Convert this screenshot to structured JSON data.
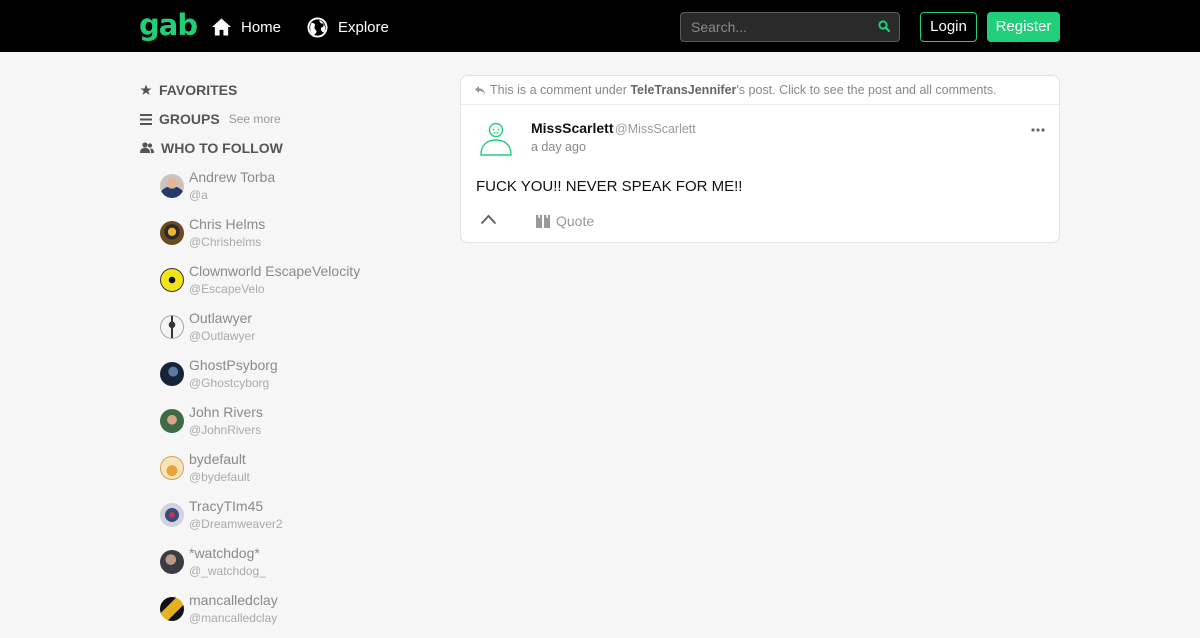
{
  "header": {
    "logo": "gab",
    "nav": [
      {
        "label": "Home",
        "icon": "home-icon"
      },
      {
        "label": "Explore",
        "icon": "globe-icon"
      }
    ],
    "search": {
      "placeholder": "Search..."
    },
    "login_label": "Login",
    "register_label": "Register"
  },
  "sidebar": {
    "favorites_label": "FAVORITES",
    "groups_label": "GROUPS",
    "groups_see_more": "See more",
    "who_to_follow_label": "WHO TO FOLLOW",
    "follow": [
      {
        "name": "Andrew Torba",
        "handle": "@a"
      },
      {
        "name": "Chris Helms",
        "handle": "@Chrishelms"
      },
      {
        "name": "Clownworld EscapeVelocity",
        "handle": "@EscapeVelo"
      },
      {
        "name": "Outlawyer",
        "handle": "@Outlawyer"
      },
      {
        "name": "GhostPsyborg",
        "handle": "@Ghostcyborg"
      },
      {
        "name": "John Rivers",
        "handle": "@JohnRivers"
      },
      {
        "name": "bydefault",
        "handle": "@bydefault"
      },
      {
        "name": "TracyTIm45",
        "handle": "@Dreamweaver2"
      },
      {
        "name": "*watchdog*",
        "handle": "@_watchdog_"
      },
      {
        "name": "mancalledclay",
        "handle": "@mancalledclay"
      }
    ]
  },
  "post": {
    "note_prefix": "This is a comment under ",
    "note_user": "TeleTransJennifer",
    "note_suffix": "'s post. Click to see the post and all comments.",
    "author_name": "MissScarlett",
    "author_handle": "@MissScarlett",
    "time": "a day ago",
    "body": "FUCK YOU!! NEVER SPEAK FOR ME!!",
    "quote_label": "Quote"
  },
  "colors": {
    "brand": "#21cf7a",
    "topbar": "#000000",
    "background": "#f6f6f6"
  }
}
